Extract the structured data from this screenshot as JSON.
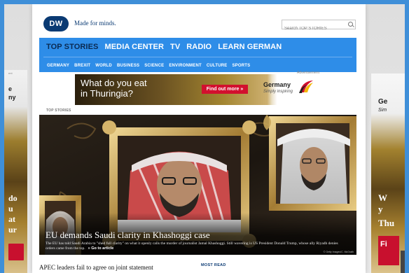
{
  "header": {
    "logo_text": "DW",
    "tagline": "Made for minds.",
    "search_placeholder": "Search TOP STORIES"
  },
  "nav": {
    "main": [
      "TOP STORIES",
      "MEDIA CENTER",
      "TV",
      "RADIO",
      "LEARN GERMAN"
    ],
    "active": "TOP STORIES",
    "sub": [
      "GERMANY",
      "BREXIT",
      "WORLD",
      "BUSINESS",
      "SCIENCE",
      "ENVIRONMENT",
      "CULTURE",
      "SPORTS"
    ]
  },
  "ads": {
    "label": "Advertisement",
    "banner": {
      "line1": "What do you eat",
      "line2": "in Thuringia?",
      "button": "Find out more",
      "brand": "Germany",
      "brand_tagline": "Simply inspiring"
    },
    "left_side": {
      "t1": "ent",
      "t2": "e",
      "t3": "ny",
      "t4": "do",
      "t5": "u",
      "t6": "at",
      "t7": "ur"
    },
    "right_side": {
      "t1": "Ge",
      "t2": "Sim",
      "t3": "W",
      "t4": "y",
      "t5": "Thu",
      "t6": "Fi"
    }
  },
  "main": {
    "section_label": "TOP STORIES",
    "hero": {
      "title": "EU demands Saudi clarity in Khashoggi case",
      "teaser": "The EU has told Saudi Arabia to \"shed full clarity\" on what it openly calls the murder of journalist Jamal Khashoggi. Still wavering is US President Donald Trump, whose ally Riyadh denies orders came from the top.",
      "link": "Go to article",
      "credit": "© Getty Images/C. McGrath"
    },
    "next_headline": "APEC leaders fail to agree on joint statement",
    "most_read_label": "MOST READ"
  },
  "colors": {
    "frame": "#3f8fd8",
    "nav": "#2e8de8",
    "dw_blue": "#0a3a73",
    "ad_red": "#d2102e"
  }
}
